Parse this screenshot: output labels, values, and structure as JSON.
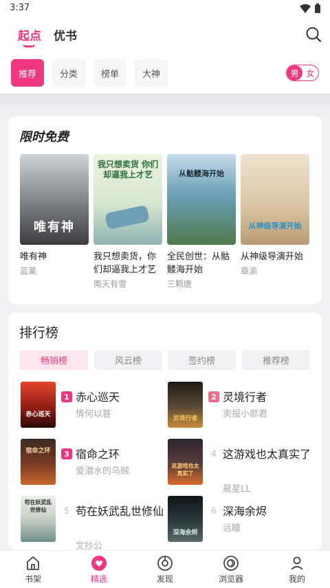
{
  "status": {
    "time": "3:37"
  },
  "header": {
    "tabs": [
      "起点",
      "优书"
    ]
  },
  "filters": {
    "chips": [
      "推荐",
      "分类",
      "榜单",
      "大神"
    ],
    "gender": [
      "男",
      "女"
    ]
  },
  "free": {
    "title": "限时免费",
    "books": [
      {
        "title": "唯有神",
        "author": "蓝薬",
        "cover_text": "唯有神"
      },
      {
        "title": "我只想卖货，你们却逼我上才艺",
        "author": "南天有雪",
        "cover_text": "我只想卖货 你们却逼我上才艺"
      },
      {
        "title": "全民创世：从骷髅海开始",
        "author": "三颗唐",
        "cover_text": "从骷髅海开始"
      },
      {
        "title": "从神级导演开始",
        "author": "章渝",
        "cover_text": "从神级导演开始"
      }
    ]
  },
  "ranking": {
    "title": "排行榜",
    "tabs": [
      "畅销榜",
      "风云榜",
      "签约榜",
      "推荐榜"
    ],
    "items": [
      {
        "rank": "1",
        "name": "赤心巡天",
        "author": "情何以甚",
        "cover_text": "赤心巡天"
      },
      {
        "rank": "2",
        "name": "灵境行者",
        "author": "卖报小郎君",
        "cover_text": "灵境行者"
      },
      {
        "rank": "3",
        "name": "宿命之环",
        "author": "爱潜水的乌贼",
        "cover_text": "宿命之环"
      },
      {
        "rank": "4",
        "name": "这游戏也太真实了",
        "author": "晨星LL",
        "cover_text": "这游戏也太真实了"
      },
      {
        "rank": "5",
        "name": "苟在妖武乱世修仙",
        "author": "文抄公",
        "cover_text": "苟在妖武乱世修仙"
      },
      {
        "rank": "6",
        "name": "深海余烬",
        "author": "远瞳",
        "cover_text": "深海余烬"
      }
    ]
  },
  "nav": [
    "书架",
    "精选",
    "发现",
    "浏览器",
    "我的"
  ],
  "colors": {
    "accent": "#f0367f"
  }
}
